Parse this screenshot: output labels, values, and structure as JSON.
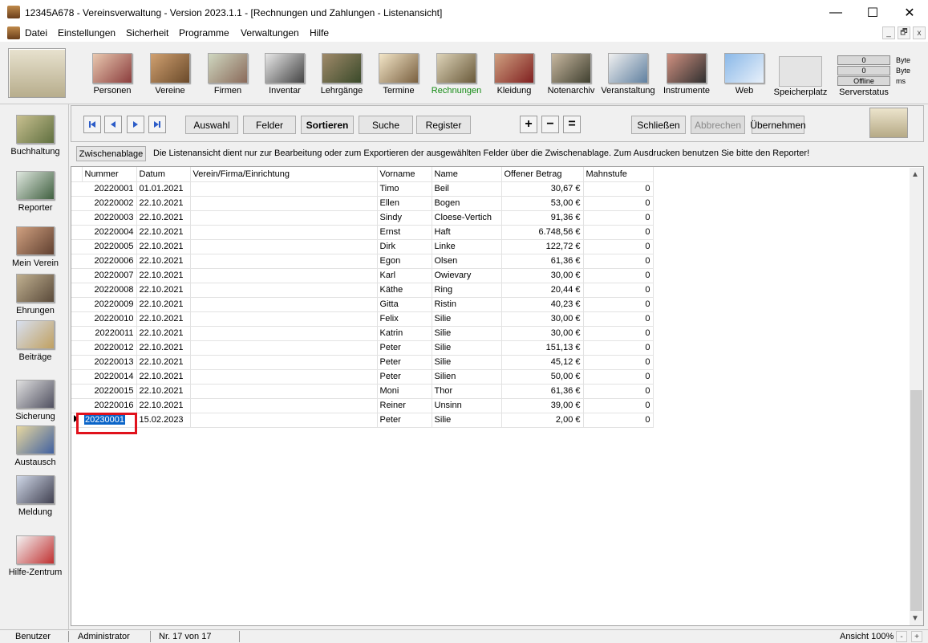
{
  "window": {
    "title": "12345A678 - Vereinsverwaltung - Version 2023.1.1 - [Rechnungen und Zahlungen - Listenansicht]",
    "minimize": "—",
    "maximize": "☐",
    "close": "✕"
  },
  "menu": [
    "Datei",
    "Einstellungen",
    "Sicherheit",
    "Programme",
    "Verwaltungen",
    "Hilfe"
  ],
  "mdi": [
    "_",
    "🗗",
    "x"
  ],
  "toolbar": {
    "items": [
      {
        "label": "Personen",
        "icon": "people-icon"
      },
      {
        "label": "Vereine",
        "icon": "club-icon"
      },
      {
        "label": "Firmen",
        "icon": "building-icon"
      },
      {
        "label": "Inventar",
        "icon": "inventory-icon"
      },
      {
        "label": "Lehrgänge",
        "icon": "course-icon"
      },
      {
        "label": "Termine",
        "icon": "calendar-icon"
      },
      {
        "label": "Rechnungen",
        "icon": "cash-register-icon",
        "active": true
      },
      {
        "label": "Kleidung",
        "icon": "clothing-icon"
      },
      {
        "label": "Notenarchiv",
        "icon": "music-archive-icon"
      },
      {
        "label": "Veranstaltung",
        "icon": "event-icon"
      },
      {
        "label": "Instrumente",
        "icon": "instruments-icon"
      },
      {
        "label": "Web",
        "icon": "cloud-icon"
      }
    ],
    "storage_label": "Speicherplatz",
    "server_label": "Serverstatus",
    "server_values": [
      "0",
      "0",
      "Offline"
    ],
    "server_units": [
      "Byte",
      "Byte",
      "ms"
    ]
  },
  "sidebar": [
    {
      "label": "Buchhaltung",
      "icon": "accounting-icon"
    },
    {
      "label": "Reporter",
      "icon": "reporter-icon"
    },
    {
      "label": "Mein Verein",
      "icon": "my-club-icon"
    },
    {
      "label": "Ehrungen",
      "icon": "honors-icon"
    },
    {
      "label": "Beiträge",
      "icon": "fees-icon"
    },
    {
      "label": "Sicherung",
      "icon": "laptop-icon"
    },
    {
      "label": "Austausch",
      "icon": "exchange-icon"
    },
    {
      "label": "Meldung",
      "icon": "report-icon"
    },
    {
      "label": "Hilfe-Zentrum",
      "icon": "ambulance-icon"
    }
  ],
  "nav": {
    "buttons": {
      "auswahl": "Auswahl",
      "felder": "Felder",
      "sortieren": "Sortieren",
      "suche": "Suche",
      "register": "Register"
    },
    "symbols": [
      "+",
      "−",
      "="
    ],
    "actions": {
      "schliessen": "Schließen",
      "abbrechen": "Abbrechen",
      "uebernehmen": "Übernehmen"
    }
  },
  "info": {
    "clipboard": "Zwischenablage",
    "text": "Die Listenansicht dient nur zur Bearbeitung oder zum Exportieren der ausgewählten Felder über die Zwischenablage. Zum Ausdrucken benutzen Sie bitte den Reporter!"
  },
  "table": {
    "columns": [
      "Nummer",
      "Datum",
      "Verein/Firma/Einrichtung",
      "Vorname",
      "Name",
      "Offener Betrag",
      "Mahnstufe"
    ],
    "rows": [
      [
        "20220001",
        "01.01.2021",
        "",
        "Timo",
        "Beil",
        "30,67 €",
        "0"
      ],
      [
        "20220002",
        "22.10.2021",
        "",
        "Ellen",
        "Bogen",
        "53,00 €",
        "0"
      ],
      [
        "20220003",
        "22.10.2021",
        "",
        "Sindy",
        "Cloese-Vertich",
        "91,36 €",
        "0"
      ],
      [
        "20220004",
        "22.10.2021",
        "",
        "Ernst",
        "Haft",
        "6.748,56 €",
        "0"
      ],
      [
        "20220005",
        "22.10.2021",
        "",
        "Dirk",
        "Linke",
        "122,72 €",
        "0"
      ],
      [
        "20220006",
        "22.10.2021",
        "",
        "Egon",
        "Olsen",
        "61,36 €",
        "0"
      ],
      [
        "20220007",
        "22.10.2021",
        "",
        "Karl",
        "Owievary",
        "30,00 €",
        "0"
      ],
      [
        "20220008",
        "22.10.2021",
        "",
        "Käthe",
        "Ring",
        "20,44 €",
        "0"
      ],
      [
        "20220009",
        "22.10.2021",
        "",
        "Gitta",
        "Ristin",
        "40,23 €",
        "0"
      ],
      [
        "20220010",
        "22.10.2021",
        "",
        "Felix",
        "Silie",
        "30,00 €",
        "0"
      ],
      [
        "20220011",
        "22.10.2021",
        "",
        "Katrin",
        "Silie",
        "30,00 €",
        "0"
      ],
      [
        "20220012",
        "22.10.2021",
        "",
        "Peter",
        "Silie",
        "151,13 €",
        "0"
      ],
      [
        "20220013",
        "22.10.2021",
        "",
        "Peter",
        "Silie",
        "45,12 €",
        "0"
      ],
      [
        "20220014",
        "22.10.2021",
        "",
        "Peter",
        "Silien",
        "50,00 €",
        "0"
      ],
      [
        "20220015",
        "22.10.2021",
        "",
        "Moni",
        "Thor",
        "61,36 €",
        "0"
      ],
      [
        "20220016",
        "22.10.2021",
        "",
        "Reiner",
        "Unsinn",
        "39,00 €",
        "0"
      ],
      [
        "20230001",
        "15.02.2023",
        "",
        "Peter",
        "Silie",
        "2,00 €",
        "0"
      ]
    ],
    "selected_row": 16
  },
  "status": {
    "user_label": "Benutzer",
    "user": "Administrator",
    "record": "Nr. 17 von 17",
    "zoom": "Ansicht 100%",
    "zoom_minus": "-",
    "zoom_plus": "+"
  }
}
